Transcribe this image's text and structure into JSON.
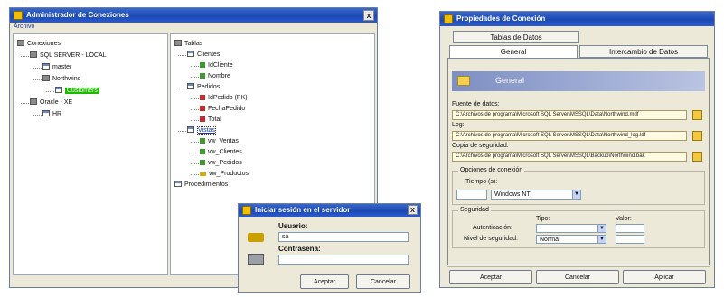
{
  "explorer": {
    "title": "Administrador de Conexiones",
    "menu": "Archivo",
    "left_tree": [
      {
        "label": "Conexiones",
        "indent": 0,
        "icon": "db"
      },
      {
        "label": "SQL SERVER - LOCAL",
        "indent": 1,
        "icon": "db"
      },
      {
        "label": "master",
        "indent": 2,
        "icon": "table"
      },
      {
        "label": "Northwind",
        "indent": 2,
        "icon": "db"
      },
      {
        "label": "Customers",
        "indent": 3,
        "icon": "table",
        "selected": true
      },
      {
        "label": "Oracle - XE",
        "indent": 1,
        "icon": "db"
      },
      {
        "label": "HR",
        "indent": 2,
        "icon": "table"
      }
    ],
    "right_tree": [
      {
        "label": "Tablas",
        "indent": 0,
        "icon": "db"
      },
      {
        "label": "Clientes",
        "indent": 1,
        "icon": "table"
      },
      {
        "label": "IdCliente",
        "indent": 2,
        "icon": "green"
      },
      {
        "label": "Nombre",
        "indent": 2,
        "icon": "green"
      },
      {
        "label": "Pedidos",
        "indent": 1,
        "icon": "table"
      },
      {
        "label": "IdPedido (PK)",
        "indent": 2,
        "icon": "red"
      },
      {
        "label": "FechaPedido",
        "indent": 2,
        "icon": "red"
      },
      {
        "label": "Total",
        "indent": 2,
        "icon": "red"
      },
      {
        "label": "Vistas",
        "indent": 1,
        "icon": "table",
        "link": true
      },
      {
        "label": "vw_Ventas",
        "indent": 2,
        "icon": "green"
      },
      {
        "label": "vw_Clientes",
        "indent": 2,
        "icon": "green"
      },
      {
        "label": "vw_Pedidos",
        "indent": 2,
        "icon": "green"
      },
      {
        "label": "vw_Productos",
        "indent": 2,
        "icon": "key"
      },
      {
        "label": "Procedimientos",
        "indent": 0,
        "icon": "table"
      }
    ]
  },
  "login": {
    "title": "Iniciar sesión en el servidor",
    "user_label": "Usuario:",
    "user_value": "sa",
    "password_label": "Contraseña:",
    "password_value": "",
    "ok_label": "Aceptar",
    "cancel_label": "Cancelar"
  },
  "props": {
    "title": "Propiedades de Conexión",
    "tab_top": "Tablas de Datos",
    "tab_general": "General",
    "tab_second": "Intercambio de Datos",
    "header_label": "General",
    "path1_label": "Fuente de datos:",
    "path1_value": "C:\\Archivos de programa\\Microsoft SQL Server\\MSSQL\\Data\\Northwind.mdf",
    "path2_label": "Log:",
    "path2_value": "C:\\Archivos de programa\\Microsoft SQL Server\\MSSQL\\Data\\Northwind_log.ldf",
    "path3_label": "Copia de seguridad:",
    "path3_value": "C:\\Archivos de programa\\Microsoft SQL Server\\MSSQL\\Backup\\Northwind.bak",
    "group1_title": "Opciones de conexión",
    "timeout_label": "Tiempo (s):",
    "timeout_value": "",
    "mode_value": "Windows NT",
    "group2_title": "Seguridad",
    "col1_header": "Tipo:",
    "col2_header": "Valor:",
    "row1_label": "Autenticación:",
    "row1_value": "",
    "row2_label": "Nivel de seguridad:",
    "row2_value": "Normal",
    "btn_ok": "Aceptar",
    "btn_cancel": "Cancelar",
    "btn_apply": "Aplicar"
  }
}
